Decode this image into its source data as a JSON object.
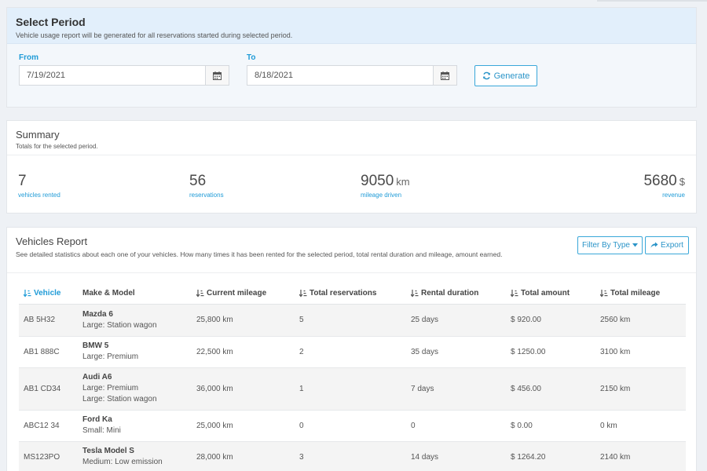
{
  "period": {
    "title": "Select Period",
    "subtitle": "Vehicle usage report will be generated for all reservations started during selected period.",
    "from_label": "From",
    "from_value": "7/19/2021",
    "to_label": "To",
    "to_value": "8/18/2021",
    "generate_label": "Generate"
  },
  "summary": {
    "title": "Summary",
    "subtitle": "Totals for the selected period.",
    "stats": [
      {
        "value": "7",
        "unit": "",
        "label": "vehicles rented"
      },
      {
        "value": "56",
        "unit": "",
        "label": "reservations"
      },
      {
        "value": "9050",
        "unit": "km",
        "label": "mileage driven"
      },
      {
        "value": "5680",
        "unit": "$",
        "label": "revenue"
      }
    ]
  },
  "report": {
    "title": "Vehicles Report",
    "subtitle": "See detailed statistics about each one of your vehicles. How many times it has been rented for the selected period, total rental duration and mileage, amount earned.",
    "filter_label": "Filter By Type",
    "export_label": "Export",
    "columns": [
      "Vehicle",
      "Make & Model",
      "Current mileage",
      "Total reservations",
      "Rental duration",
      "Total amount",
      "Total mileage"
    ],
    "rows": [
      {
        "vehicle": "AB 5H32",
        "make": "Mazda 6",
        "types": [
          "Large: Station wagon"
        ],
        "mileage": "25,800 km",
        "reservations": "5",
        "duration": "25 days",
        "amount": "$ 920.00",
        "total_mileage": "2560 km"
      },
      {
        "vehicle": "AB1 888C",
        "make": "BMW 5",
        "types": [
          "Large: Premium"
        ],
        "mileage": "22,500 km",
        "reservations": "2",
        "duration": "35 days",
        "amount": "$ 1250.00",
        "total_mileage": "3100 km"
      },
      {
        "vehicle": "AB1 CD34",
        "make": "Audi A6",
        "types": [
          "Large: Premium",
          "Large: Station wagon"
        ],
        "mileage": "36,000 km",
        "reservations": "1",
        "duration": "7 days",
        "amount": "$ 456.00",
        "total_mileage": "2150 km"
      },
      {
        "vehicle": "ABC12 34",
        "make": "Ford Ka",
        "types": [
          "Small: Mini"
        ],
        "mileage": "25,000 km",
        "reservations": "0",
        "duration": "0",
        "amount": "$ 0.00",
        "total_mileage": "0 km"
      },
      {
        "vehicle": "MS123PO",
        "make": "Tesla Model S",
        "types": [
          "Medium: Low emission"
        ],
        "mileage": "28,000 km",
        "reservations": "3",
        "duration": "14 days",
        "amount": "$ 1264.20",
        "total_mileage": "2140 km"
      }
    ]
  },
  "colors": {
    "accent": "#1f9bd7",
    "header_band": "#e2effb",
    "page_bg": "#eef1f5"
  },
  "icons": [
    "calendar-icon",
    "refresh-icon",
    "caret-down-icon",
    "export-icon",
    "sort-icon"
  ]
}
